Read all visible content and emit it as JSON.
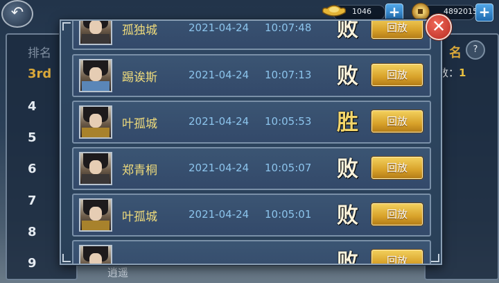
{
  "topbar": {
    "back_icon": "back-arrow-icon",
    "ingot_value": "1046",
    "coin_value": "4892015",
    "plus_label": "+"
  },
  "background": {
    "rank_header": "排名",
    "ranks": [
      "3rd",
      "4",
      "5",
      "6",
      "7",
      "8",
      "9"
    ],
    "right_title": "名",
    "help_label": "?",
    "count_label": "数：",
    "count_value": "1",
    "bottom_name": "逍遥"
  },
  "modal": {
    "close_label": "✕",
    "records": [
      {
        "name": "孤独城",
        "date": "2021-04-24",
        "time": "10:07:48",
        "result": "败",
        "replay": "回放",
        "avatar": "dark"
      },
      {
        "name": "踢诶斯",
        "date": "2021-04-24",
        "time": "10:07:13",
        "result": "败",
        "replay": "回放",
        "avatar": "blue"
      },
      {
        "name": "叶孤城",
        "date": "2021-04-24",
        "time": "10:05:53",
        "result": "胜",
        "replay": "回放",
        "avatar": "gold"
      },
      {
        "name": "郑青桐",
        "date": "2021-04-24",
        "time": "10:05:07",
        "result": "败",
        "replay": "回放",
        "avatar": "dark"
      },
      {
        "name": "叶孤城",
        "date": "2021-04-24",
        "time": "10:05:01",
        "result": "败",
        "replay": "回放",
        "avatar": "gold"
      },
      {
        "name": "",
        "date": "",
        "time": "",
        "result": "败",
        "replay": "回放",
        "avatar": "dark"
      }
    ]
  },
  "colors": {
    "accent_gold": "#f0dc7c",
    "time_blue": "#8cc4ec",
    "close_red": "#d0392e"
  }
}
